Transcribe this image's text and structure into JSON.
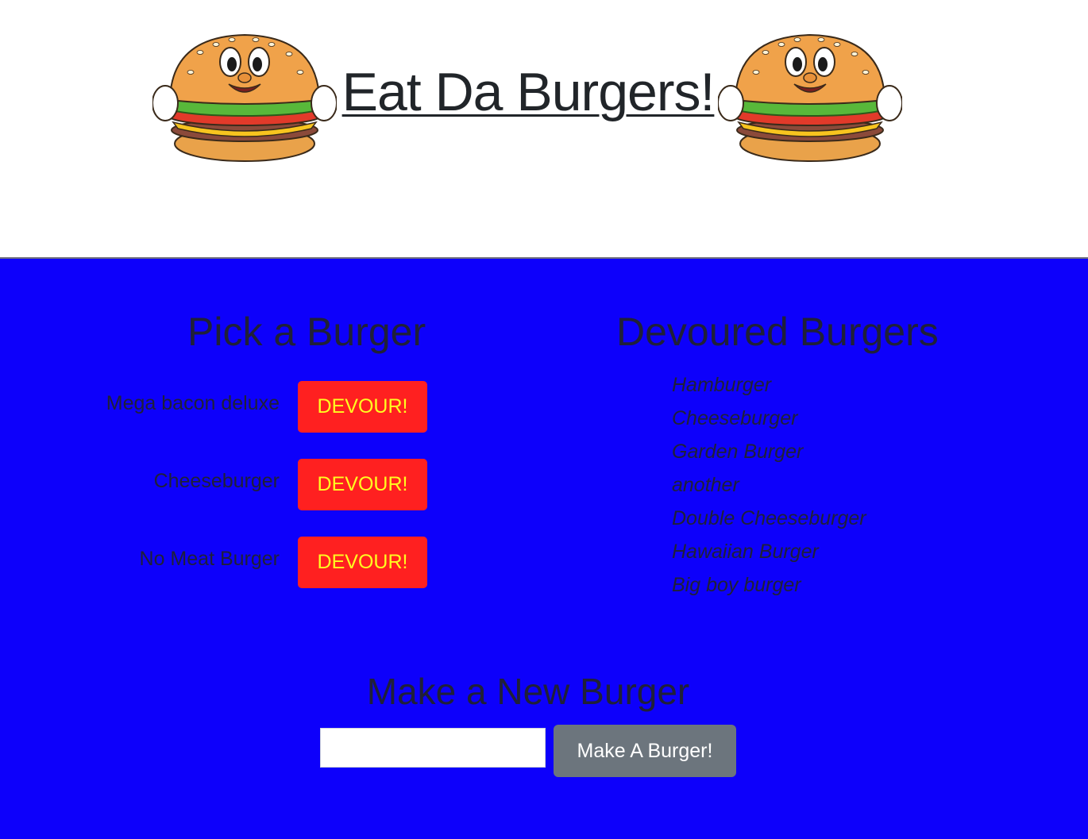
{
  "header": {
    "title": "Eat Da Burgers!",
    "left_image": "burger-mascot",
    "right_image": "burger-mascot"
  },
  "pick": {
    "heading": "Pick a Burger",
    "items": [
      {
        "name": "Mega bacon deluxe",
        "button": "DEVOUR!"
      },
      {
        "name": "Cheeseburger",
        "button": "DEVOUR!"
      },
      {
        "name": "No Meat Burger",
        "button": "DEVOUR!"
      }
    ]
  },
  "devoured": {
    "heading": "Devoured Burgers",
    "items": [
      "Hamburger",
      "Cheeseburger",
      "Garden Burger",
      "another",
      "Double Cheeseburger",
      "Hawaiian Burger",
      "Big boy burger"
    ]
  },
  "create": {
    "heading": "Make a New Burger",
    "input_value": "",
    "input_placeholder": "",
    "button": "Make A Burger!"
  },
  "colors": {
    "main_background": "#0d00fb",
    "devour_button": "#ff2020",
    "devour_text": "#ffff20",
    "make_button": "#6c757d"
  }
}
